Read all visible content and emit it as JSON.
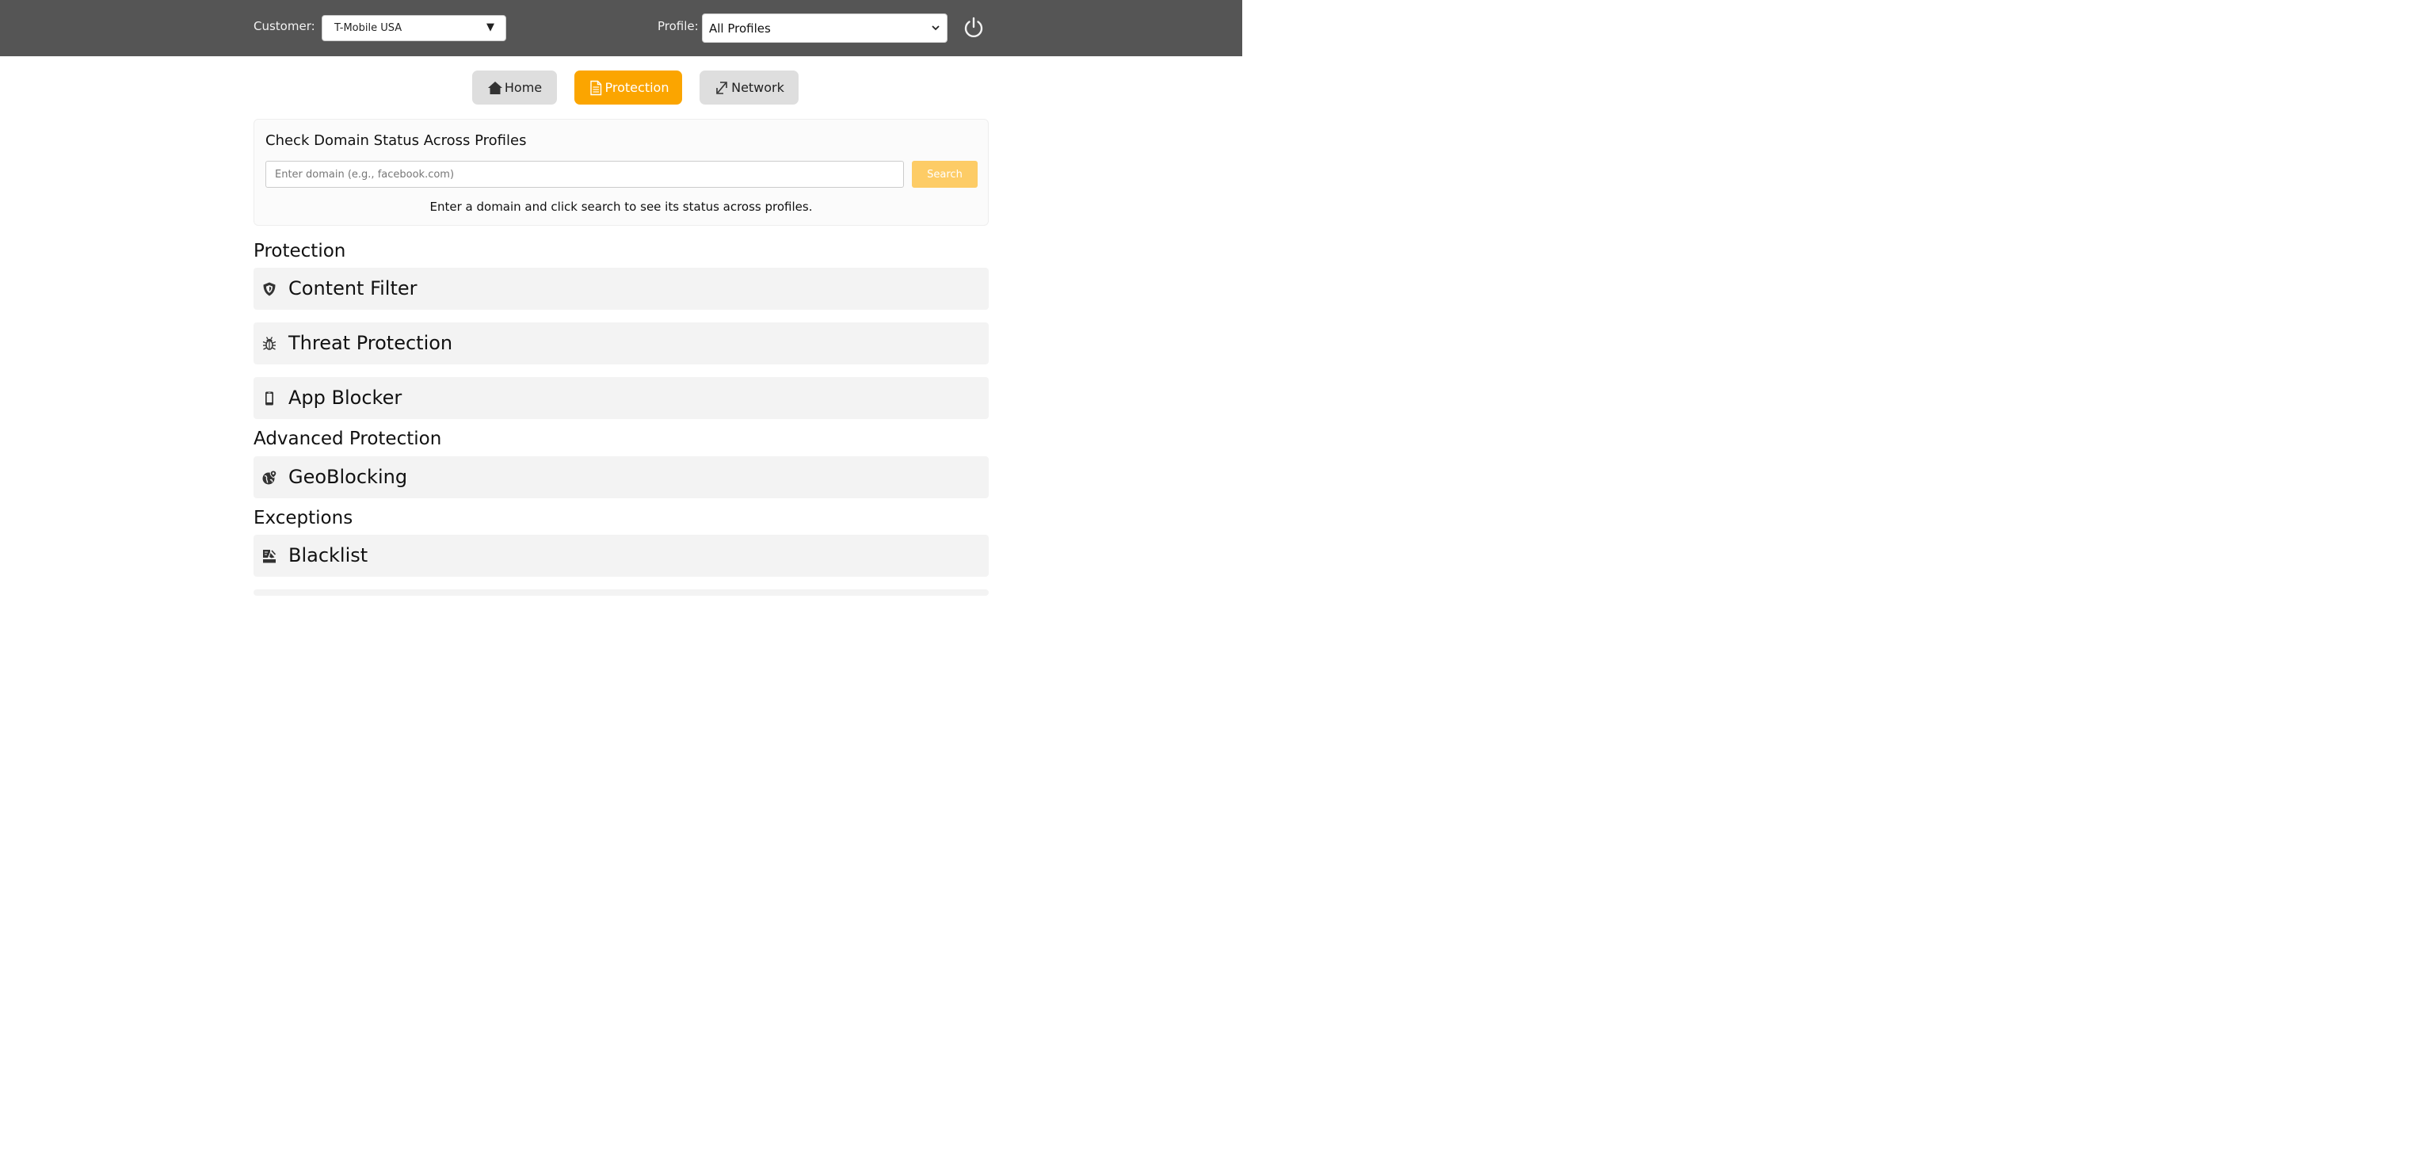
{
  "header": {
    "customer_label": "Customer:",
    "customer_value": "T-Mobile USA",
    "customer_arrow": "▼",
    "profile_label": "Profile:",
    "profile_value": "All Profiles",
    "power_icon": "power-icon"
  },
  "tabs": [
    {
      "label": "Home",
      "icon": "home-icon",
      "active": false
    },
    {
      "label": "Protection",
      "icon": "document-icon",
      "active": true
    },
    {
      "label": "Network",
      "icon": "link-icon",
      "active": false
    }
  ],
  "domain_check": {
    "title": "Check Domain Status Across Profiles",
    "placeholder": "Enter domain (e.g., facebook.com)",
    "value": "",
    "search_label": "Search",
    "hint": "Enter a domain and click search to see its status across profiles."
  },
  "sections": [
    {
      "heading": "Protection",
      "items": [
        {
          "label": "Content Filter",
          "icon": "shield-icon"
        },
        {
          "label": "Threat Protection",
          "icon": "bug-icon"
        },
        {
          "label": "App Blocker",
          "icon": "mobile-icon"
        }
      ]
    },
    {
      "heading": "Advanced Protection",
      "items": [
        {
          "label": "GeoBlocking",
          "icon": "globe-pin-icon"
        }
      ]
    },
    {
      "heading": "Exceptions",
      "items": [
        {
          "label": "Blacklist",
          "icon": "blacklist-icon"
        }
      ]
    }
  ],
  "colors": {
    "topbar": "#555555",
    "accent": "#fba500",
    "search_button": "#fdcc66",
    "row_background": "#f3f3f3",
    "tab_background": "#dedede"
  }
}
